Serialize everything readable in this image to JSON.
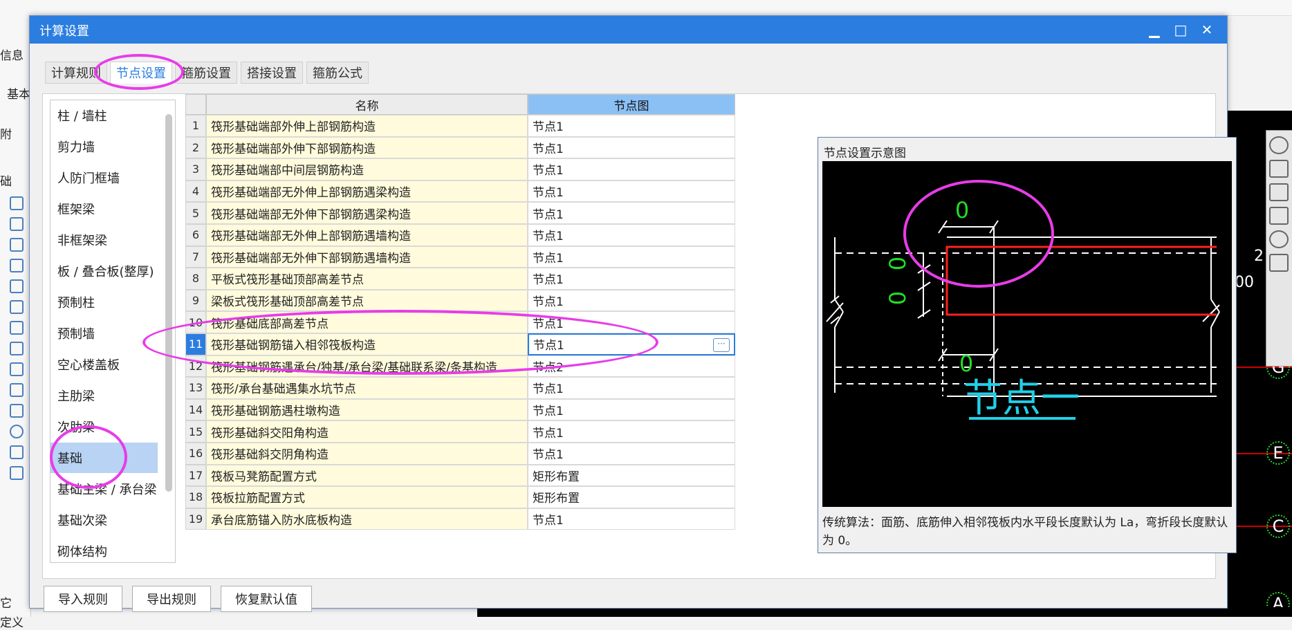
{
  "background": {
    "left_labels": [
      "信息",
      "基本",
      "附",
      "础",
      "它",
      "定义"
    ],
    "axis_labels": [
      "G",
      "E",
      "C",
      "A"
    ],
    "coord_numbers": [
      "2",
      "00"
    ]
  },
  "dialog": {
    "title": "计算设置",
    "window_buttons": {
      "minimize": "▁",
      "maximize": "□",
      "close": "✕"
    },
    "tabs": [
      {
        "label": "计算规则",
        "active": false
      },
      {
        "label": "节点设置",
        "active": true
      },
      {
        "label": "箍筋设置",
        "active": false
      },
      {
        "label": "搭接设置",
        "active": false
      },
      {
        "label": "箍筋公式",
        "active": false
      }
    ],
    "categories": [
      "柱 / 墙柱",
      "剪力墙",
      "人防门框墙",
      "框架梁",
      "非框架梁",
      "板 / 叠合板(整厚)",
      "预制柱",
      "预制墙",
      "空心楼盖板",
      "主肋梁",
      "次肋梁",
      "基础",
      "基础主梁 / 承台梁",
      "基础次梁",
      "砌体结构"
    ],
    "selected_category": "基础",
    "table": {
      "headers": {
        "name": "名称",
        "node": "节点图"
      },
      "rows": [
        {
          "no": "1",
          "name": "筏形基础端部外伸上部钢筋构造",
          "node": "节点1"
        },
        {
          "no": "2",
          "name": "筏形基础端部外伸下部钢筋构造",
          "node": "节点1"
        },
        {
          "no": "3",
          "name": "筏形基础端部中间层钢筋构造",
          "node": "节点1"
        },
        {
          "no": "4",
          "name": "筏形基础端部无外伸上部钢筋遇梁构造",
          "node": "节点1"
        },
        {
          "no": "5",
          "name": "筏形基础端部无外伸下部钢筋遇梁构造",
          "node": "节点1"
        },
        {
          "no": "6",
          "name": "筏形基础端部无外伸上部钢筋遇墙构造",
          "node": "节点1"
        },
        {
          "no": "7",
          "name": "筏形基础端部无外伸下部钢筋遇墙构造",
          "node": "节点1"
        },
        {
          "no": "8",
          "name": "平板式筏形基础顶部高差节点",
          "node": "节点1"
        },
        {
          "no": "9",
          "name": "梁板式筏形基础顶部高差节点",
          "node": "节点1"
        },
        {
          "no": "10",
          "name": "筏形基础底部高差节点",
          "node": "节点1"
        },
        {
          "no": "11",
          "name": "筏形基础钢筋锚入相邻筏板构造",
          "node": "节点1"
        },
        {
          "no": "12",
          "name": "筏形基础钢筋遇承台/独基/承台梁/基础联系梁/条基构造",
          "node": "节点2"
        },
        {
          "no": "13",
          "name": "筏形/承台基础遇集水坑节点",
          "node": "节点1"
        },
        {
          "no": "14",
          "name": "筏形基础钢筋遇柱墩构造",
          "node": "节点1"
        },
        {
          "no": "15",
          "name": "筏形基础斜交阳角构造",
          "node": "节点1"
        },
        {
          "no": "16",
          "name": "筏形基础斜交阴角构造",
          "node": "节点1"
        },
        {
          "no": "17",
          "name": "筏板马凳筋配置方式",
          "node": "矩形布置"
        },
        {
          "no": "18",
          "name": "筏板拉筋配置方式",
          "node": "矩形布置"
        },
        {
          "no": "19",
          "name": "承台底筋锚入防水底板构造",
          "node": "节点1"
        }
      ],
      "selected_row": "11",
      "edit_button": "···"
    },
    "preview": {
      "title": "节点设置示意图",
      "diagram_caption": "节点一",
      "dim_labels": [
        "0",
        "0",
        "0",
        "0"
      ],
      "description": "传统算法：面筋、底筋伸入相邻筏板内水平段长度默认为 La，弯折段长度默认为 0。"
    },
    "buttons": {
      "import": "导入规则",
      "export": "导出规则",
      "reset": "恢复默认值"
    }
  },
  "colors": {
    "accent": "#2b7de0",
    "highlight_circle": "#e83ce8",
    "cad_green": "#22dd22",
    "cad_cyan": "#20d0e8",
    "cad_red": "#ff2020"
  }
}
